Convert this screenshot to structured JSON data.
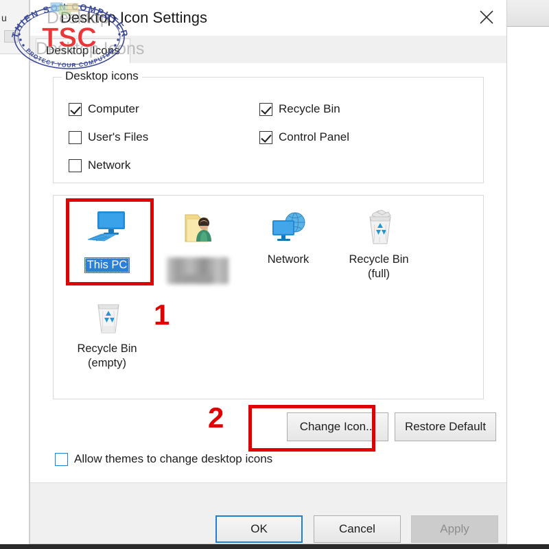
{
  "window": {
    "title": "Desktop Icon Settings",
    "close_icon": "close-icon",
    "tab_label": "Desktop Icons"
  },
  "background": {
    "left_fragment": "u"
  },
  "group": {
    "legend": "Desktop icons",
    "checkboxes": [
      {
        "label": "Computer",
        "checked": true,
        "column": 1,
        "row": 1
      },
      {
        "label": "User's Files",
        "checked": false,
        "column": 1,
        "row": 2
      },
      {
        "label": "Network",
        "checked": false,
        "column": 1,
        "row": 3
      },
      {
        "label": "Recycle Bin",
        "checked": true,
        "column": 2,
        "row": 1
      },
      {
        "label": "Control Panel",
        "checked": true,
        "column": 2,
        "row": 2
      }
    ]
  },
  "icon_preview": {
    "items": [
      {
        "icon": "this-pc-icon",
        "caption": "This PC",
        "selected": true,
        "blurred": false
      },
      {
        "icon": "user-folder-icon",
        "caption": "",
        "selected": false,
        "blurred": true
      },
      {
        "icon": "network-icon",
        "caption": "Network",
        "selected": false,
        "blurred": false
      },
      {
        "icon": "recycle-bin-full-icon",
        "caption": "Recycle Bin\n(full)",
        "selected": false,
        "blurred": false
      },
      {
        "icon": "recycle-bin-empty-icon",
        "caption": "Recycle Bin\n(empty)",
        "selected": false,
        "blurred": false
      }
    ],
    "captions": {
      "this_pc": "This PC",
      "network": "Network",
      "recycle_full_line1": "Recycle Bin",
      "recycle_full_line2": "(full)",
      "recycle_empty_line1": "Recycle Bin",
      "recycle_empty_line2": "(empty)"
    }
  },
  "actions": {
    "change_icon": "Change Icon...",
    "restore_default": "Restore Default",
    "allow_themes": "Allow themes to change desktop icons",
    "allow_themes_checked": false
  },
  "footer": {
    "ok": "OK",
    "cancel": "Cancel",
    "apply": "Apply",
    "apply_enabled": false
  },
  "annotations": {
    "step_1": "1",
    "step_2": "2",
    "accent_color": "#e00000"
  },
  "watermark": {
    "top_arc": "THIEN SON COMPUTER",
    "center": "TSC",
    "bottom_arc": "PROTECT YOUR COMPUTER",
    "ghost_text_1": "Desktop",
    "ghost_text_2": "Desktop Icons",
    "center_color": "#e8282c",
    "arc_color": "#2d3b8e"
  }
}
